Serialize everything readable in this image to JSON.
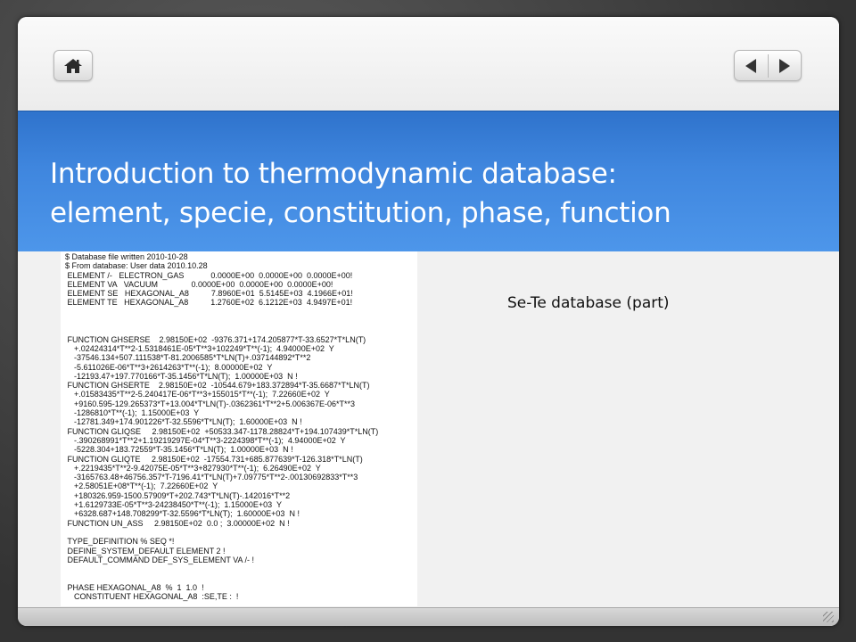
{
  "slide": {
    "title_line1": "Introduction to thermodynamic database:",
    "title_line2": "element, specie, constitution, phase, function",
    "caption": "Se-Te database (part)"
  },
  "nav": {
    "home_icon": "home-icon",
    "prev_icon": "triangle-left-icon",
    "next_icon": "triangle-right-icon"
  },
  "colors": {
    "title_band": "#3f86de",
    "slide_bg": "#f1f1f1",
    "title_text": "#ffffff"
  },
  "database_lines": [
    "$ Database file written 2010-10-28",
    "$ From database: User data 2010.10.28",
    " ELEMENT /-   ELECTRON_GAS            0.0000E+00  0.0000E+00  0.0000E+00!",
    " ELEMENT VA   VACUUM               0.0000E+00  0.0000E+00  0.0000E+00!",
    " ELEMENT SE   HEXAGONAL_A8          7.8960E+01  5.5145E+03  4.1966E+01!",
    " ELEMENT TE   HEXAGONAL_A8          1.2760E+02  6.1212E+03  4.9497E+01!",
    "",
    "",
    "",
    " FUNCTION GHSERSE    2.98150E+02  -9376.371+174.205877*T-33.6527*T*LN(T)",
    "    +.02424314*T**2-1.5318461E-05*T**3+102249*T**(-1);  4.94000E+02  Y",
    "    -37546.134+507.111538*T-81.2006585*T*LN(T)+.037144892*T**2",
    "    -5.611026E-06*T**3+2614263*T**(-1);  8.00000E+02  Y",
    "    -12193.47+197.770166*T-35.1456*T*LN(T);  1.00000E+03  N !",
    " FUNCTION GHSERTE    2.98150E+02  -10544.679+183.372894*T-35.6687*T*LN(T)",
    "    +.01583435*T**2-5.240417E-06*T**3+155015*T**(-1);  7.22660E+02  Y",
    "    +9160.595-129.265373*T+13.004*T*LN(T)-.0362361*T**2+5.006367E-06*T**3",
    "    -1286810*T**(-1);  1.15000E+03  Y",
    "    -12781.349+174.901226*T-32.5596*T*LN(T);  1.60000E+03  N !",
    " FUNCTION GLIQSE     2.98150E+02  +50533.347-1178.28824*T+194.107439*T*LN(T)",
    "    -.390268991*T**2+1.19219297E-04*T**3-2224398*T**(-1);  4.94000E+02  Y",
    "    -5228.304+183.72559*T-35.1456*T*LN(T);  1.00000E+03  N !",
    " FUNCTION GLIQTE     2.98150E+02  -17554.731+685.877639*T-126.318*T*LN(T)",
    "    +.2219435*T**2-9.42075E-05*T**3+827930*T**(-1);  6.26490E+02  Y",
    "    -3165763.48+46756.357*T-7196.41*T*LN(T)+7.09775*T**2-.00130692833*T**3",
    "    +2.58051E+08*T**(-1);  7.22660E+02  Y",
    "    +180326.959-1500.57909*T+202.743*T*LN(T)-.142016*T**2",
    "    +1.6129733E-05*T**3-24238450*T**(-1);  1.15000E+03  Y",
    "    +6328.687+148.708299*T-32.5596*T*LN(T);  1.60000E+03  N !",
    " FUNCTION UN_ASS     2.98150E+02  0.0 ;  3.00000E+02  N !",
    "",
    " TYPE_DEFINITION % SEQ *!",
    " DEFINE_SYSTEM_DEFAULT ELEMENT 2 !",
    " DEFAULT_COMMAND DEF_SYS_ELEMENT VA /- !",
    "",
    "",
    " PHASE HEXAGONAL_A8  %  1  1.0  !",
    "    CONSTITUENT HEXAGONAL_A8  :SE,TE :  !"
  ]
}
